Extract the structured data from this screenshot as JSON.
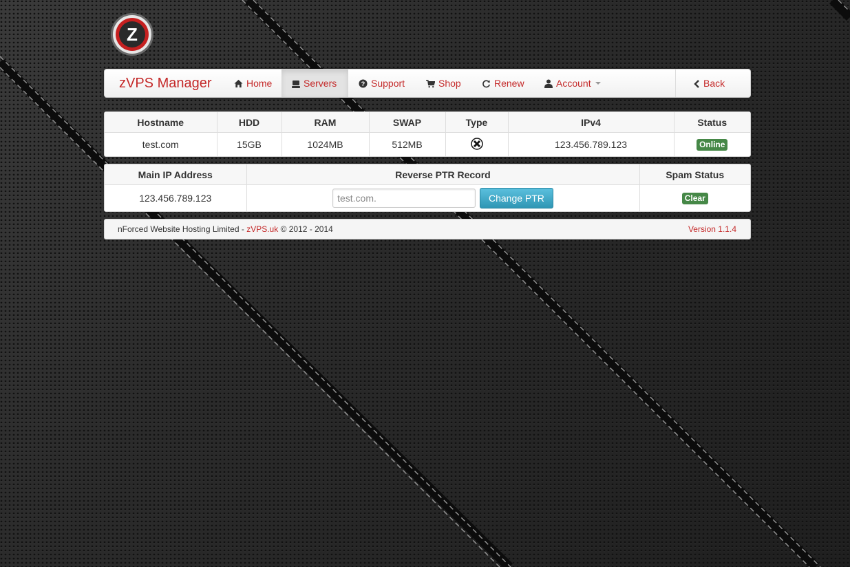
{
  "brand": {
    "logo_letter": "Z",
    "title": "zVPS Manager"
  },
  "nav": {
    "home": "Home",
    "servers": "Servers",
    "support": "Support",
    "shop": "Shop",
    "renew": "Renew",
    "account": "Account",
    "back": "Back"
  },
  "servers_table": {
    "headers": [
      "Hostname",
      "HDD",
      "RAM",
      "SWAP",
      "Type",
      "IPv4",
      "Status"
    ],
    "row": {
      "hostname": "test.com",
      "hdd": "15GB",
      "ram": "1024MB",
      "swap": "512MB",
      "type_icon": "xen-icon",
      "ipv4": "123.456.789.123",
      "status": "Online"
    }
  },
  "ptr_table": {
    "headers": [
      "Main IP Address",
      "Reverse PTR Record",
      "Spam Status"
    ],
    "row": {
      "ip": "123.456.789.123",
      "ptr_placeholder": "test.com.",
      "button": "Change PTR",
      "spam_status": "Clear"
    }
  },
  "footer": {
    "company": "nForced Website Hosting Limited -",
    "link": "zVPS.uk",
    "copyright": "© 2012 - 2014",
    "version": "Version 1.1.4"
  },
  "colors": {
    "accent": "#c42828",
    "success": "#468847",
    "info_button": "#5bc0de"
  }
}
